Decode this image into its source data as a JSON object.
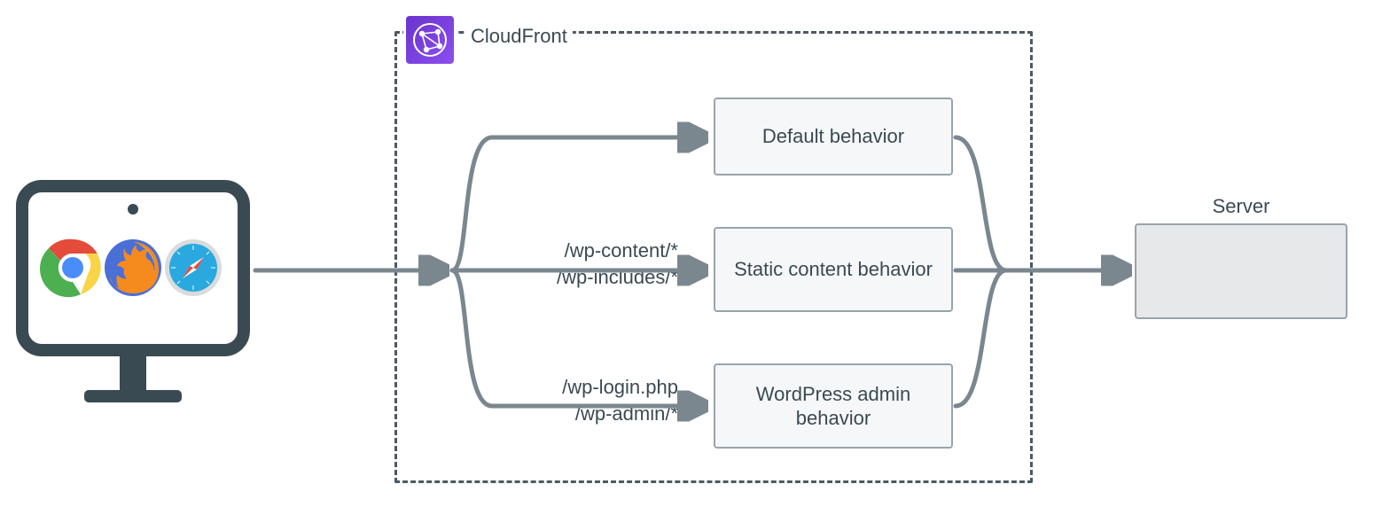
{
  "cloudfront": {
    "title": "CloudFront"
  },
  "behaviors": {
    "b1": {
      "label": "Default behavior"
    },
    "b2": {
      "label": "Static content behavior",
      "paths": "/wp-content/*\n/wp-includes/*"
    },
    "b3": {
      "label": "WordPress admin behavior",
      "paths": "/wp-login.php\n/wp-admin/*"
    }
  },
  "server": {
    "label": "Server"
  },
  "icons": {
    "client": "browser-client",
    "cloudfront": "cloudfront-icon"
  }
}
